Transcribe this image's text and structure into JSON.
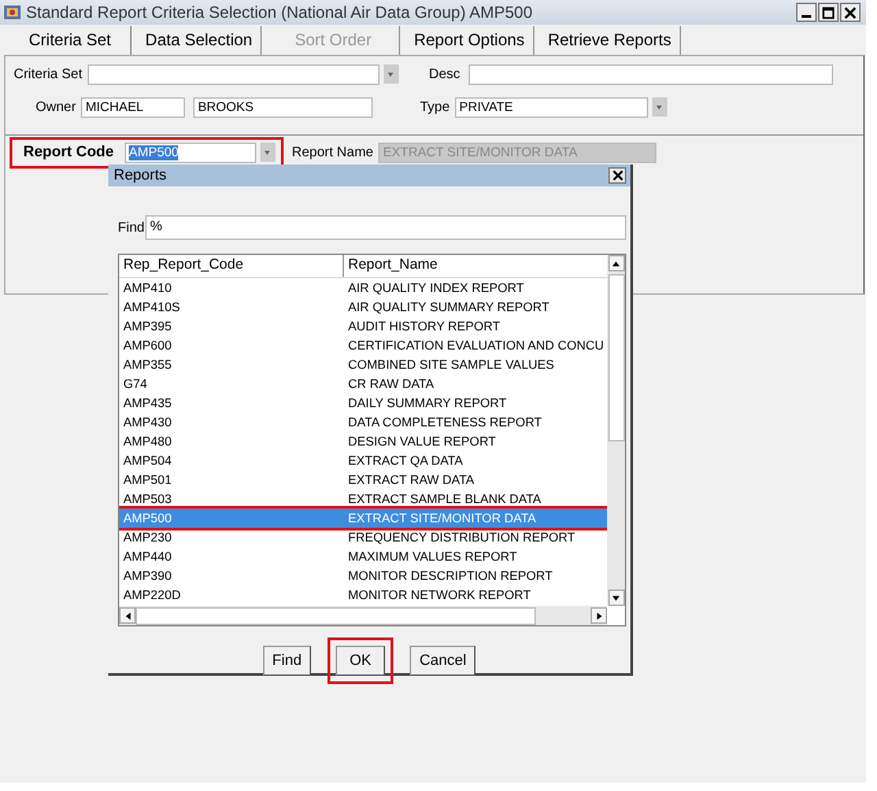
{
  "window": {
    "title": "Standard Report Criteria Selection (National Air Data Group) AMP500"
  },
  "tabs": [
    {
      "label": "Criteria Set",
      "selected": true,
      "disabled": false
    },
    {
      "label": "Data Selection",
      "selected": false,
      "disabled": false
    },
    {
      "label": "Sort Order",
      "selected": false,
      "disabled": true
    },
    {
      "label": "Report Options",
      "selected": false,
      "disabled": false
    },
    {
      "label": "Retrieve Reports",
      "selected": false,
      "disabled": false
    }
  ],
  "criteria": {
    "criteria_set": {
      "label": "Criteria Set"
    },
    "desc": {
      "label": "Desc"
    },
    "owner": {
      "label": "Owner",
      "first": "MICHAEL",
      "last": "BROOKS"
    },
    "type": {
      "label": "Type",
      "value": "PRIVATE"
    }
  },
  "report_code": {
    "label": "Report Code",
    "value": "AMP500",
    "highlight": true
  },
  "report_name": {
    "label": "Report Name",
    "value": "EXTRACT SITE/MONITOR DATA",
    "disabled": true
  },
  "dialog": {
    "title": "Reports",
    "find_label": "Find",
    "find_value": "%",
    "columns": [
      "Rep_Report_Code",
      "Report_Name"
    ],
    "rows": [
      {
        "code": "AMP410",
        "name": "AIR QUALITY INDEX REPORT",
        "selected": false,
        "highlight": false
      },
      {
        "code": "AMP410S",
        "name": "AIR QUALITY SUMMARY REPORT",
        "selected": false,
        "highlight": false
      },
      {
        "code": "AMP395",
        "name": "AUDIT HISTORY REPORT",
        "selected": false,
        "highlight": false
      },
      {
        "code": "AMP600",
        "name": "CERTIFICATION EVALUATION AND CONCU",
        "selected": false,
        "highlight": false
      },
      {
        "code": "AMP355",
        "name": "COMBINED SITE SAMPLE VALUES",
        "selected": false,
        "highlight": false
      },
      {
        "code": "G74",
        "name": "CR RAW DATA",
        "selected": false,
        "highlight": false
      },
      {
        "code": "AMP435",
        "name": "DAILY SUMMARY REPORT",
        "selected": false,
        "highlight": false
      },
      {
        "code": "AMP430",
        "name": "DATA COMPLETENESS REPORT",
        "selected": false,
        "highlight": false
      },
      {
        "code": "AMP480",
        "name": "DESIGN VALUE REPORT",
        "selected": false,
        "highlight": false
      },
      {
        "code": "AMP504",
        "name": "EXTRACT QA DATA",
        "selected": false,
        "highlight": false
      },
      {
        "code": "AMP501",
        "name": "EXTRACT RAW DATA",
        "selected": false,
        "highlight": false
      },
      {
        "code": "AMP503",
        "name": "EXTRACT SAMPLE BLANK DATA",
        "selected": false,
        "highlight": false
      },
      {
        "code": "AMP500",
        "name": "EXTRACT SITE/MONITOR DATA",
        "selected": true,
        "highlight": true
      },
      {
        "code": "AMP230",
        "name": "FREQUENCY DISTRIBUTION REPORT",
        "selected": false,
        "highlight": false
      },
      {
        "code": "AMP440",
        "name": "MAXIMUM VALUES REPORT",
        "selected": false,
        "highlight": false
      },
      {
        "code": "AMP390",
        "name": "MONITOR DESCRIPTION REPORT",
        "selected": false,
        "highlight": false
      },
      {
        "code": "AMP220D",
        "name": "MONITOR NETWORK REPORT",
        "selected": false,
        "highlight": false
      }
    ],
    "buttons": [
      {
        "label": "Find",
        "highlight": false
      },
      {
        "label": "OK",
        "highlight": true
      },
      {
        "label": "Cancel",
        "highlight": false
      }
    ]
  }
}
